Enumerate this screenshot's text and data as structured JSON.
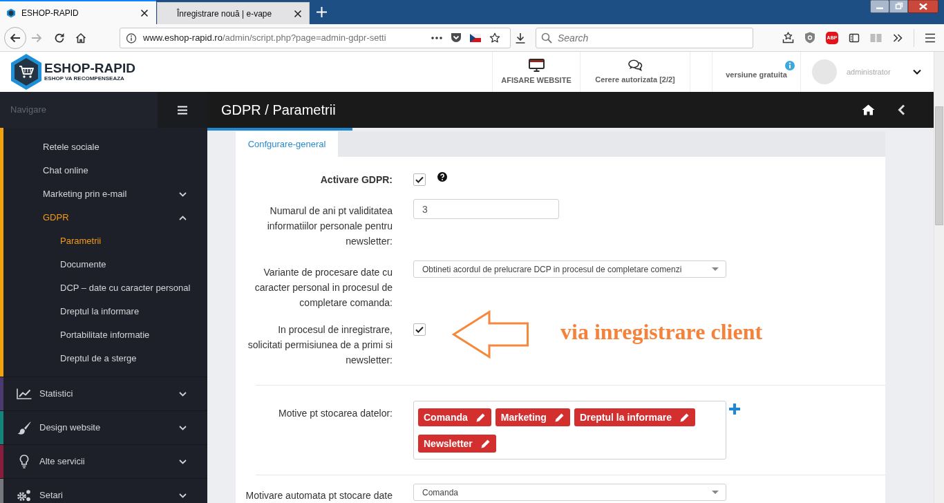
{
  "browser": {
    "tabs": [
      {
        "title": "ESHOP-RAPID",
        "selected": true
      },
      {
        "title": "Înregistrare nouă | e-vape",
        "selected": false
      }
    ],
    "address": {
      "host": "www.eshop-rapid.ro",
      "path": "/admin/script.php?page=admin-gdpr-setti"
    },
    "search": {
      "placeholder": "Search"
    },
    "adblock_label": "ABP"
  },
  "header": {
    "logo": {
      "name": "ESHOP-RAPID",
      "tagline": "ESHOP VA RECOMPENSEAZA"
    },
    "links": [
      {
        "label": "AFISARE WEBSITE"
      },
      {
        "label": "Cerere autorizata [2/2]"
      }
    ],
    "version": {
      "label": "versiune gratuita"
    },
    "user": {
      "name": "administrator"
    }
  },
  "sidebar": {
    "title": "Navigare",
    "sections": [
      {
        "color": "#f0a30a",
        "expanded": true,
        "children": [
          {
            "kind": "link",
            "label": "Retele sociale",
            "selected": false
          },
          {
            "kind": "link",
            "label": "Chat online",
            "selected": false
          },
          {
            "kind": "group",
            "label": "Marketing prin e-mail",
            "selected": false,
            "expanded": false
          },
          {
            "kind": "group",
            "label": "GDPR",
            "selected": true,
            "expanded": true,
            "children": [
              {
                "label": "Parametrii",
                "selected": true
              },
              {
                "label": "Documente",
                "selected": false
              },
              {
                "label": "DCP – date cu caracter personal",
                "selected": false
              },
              {
                "label": "Dreptul la informare",
                "selected": false
              },
              {
                "label": "Portabilitate informatie",
                "selected": false
              },
              {
                "label": "Dreptul de a sterge",
                "selected": false
              }
            ]
          }
        ]
      },
      {
        "label": "Statistici",
        "color": "#4b3a70",
        "expanded": false
      },
      {
        "label": "Design website",
        "color": "#13857a",
        "expanded": false
      },
      {
        "label": "Alte servicii",
        "color": "#8a1c3e",
        "expanded": false
      },
      {
        "label": "Setari",
        "color": "#76787e",
        "expanded": false
      }
    ]
  },
  "page": {
    "title": "GDPR / Parametrii",
    "tabs": [
      {
        "label": "Confgurare-general",
        "selected": true
      }
    ],
    "groups": [
      {
        "fields": [
          {
            "kind": "checkbox",
            "label": "Activare GDPR:",
            "bold": true,
            "help": true,
            "checked": true
          },
          {
            "kind": "text",
            "label": "Numarul de ani pt validitatea informatiilor personale pentru newsletter:",
            "value": "3"
          },
          {
            "kind": "select",
            "label": "Variante de procesare date cu caracter personal in procesul de completare comanda:",
            "value": "Obtineti acordul de prelucrare DCP in procesul de completare comenzi"
          },
          {
            "kind": "checkbox",
            "label": "In procesul de inregistrare, solicitati permisiunea de a primi si newsletter:",
            "checked": true
          }
        ]
      },
      {
        "fields": [
          {
            "kind": "tags",
            "label": "Motive pt stocarea datelor:",
            "tags": [
              "Comanda",
              "Marketing",
              "Dreptul la informare",
              "Newsletter"
            ]
          }
        ]
      },
      {
        "fields": [
          {
            "kind": "select",
            "label": "Motivare automata pt stocare date",
            "value": "Comanda"
          }
        ]
      }
    ],
    "annotation": {
      "text": "via inregistrare client"
    }
  }
}
